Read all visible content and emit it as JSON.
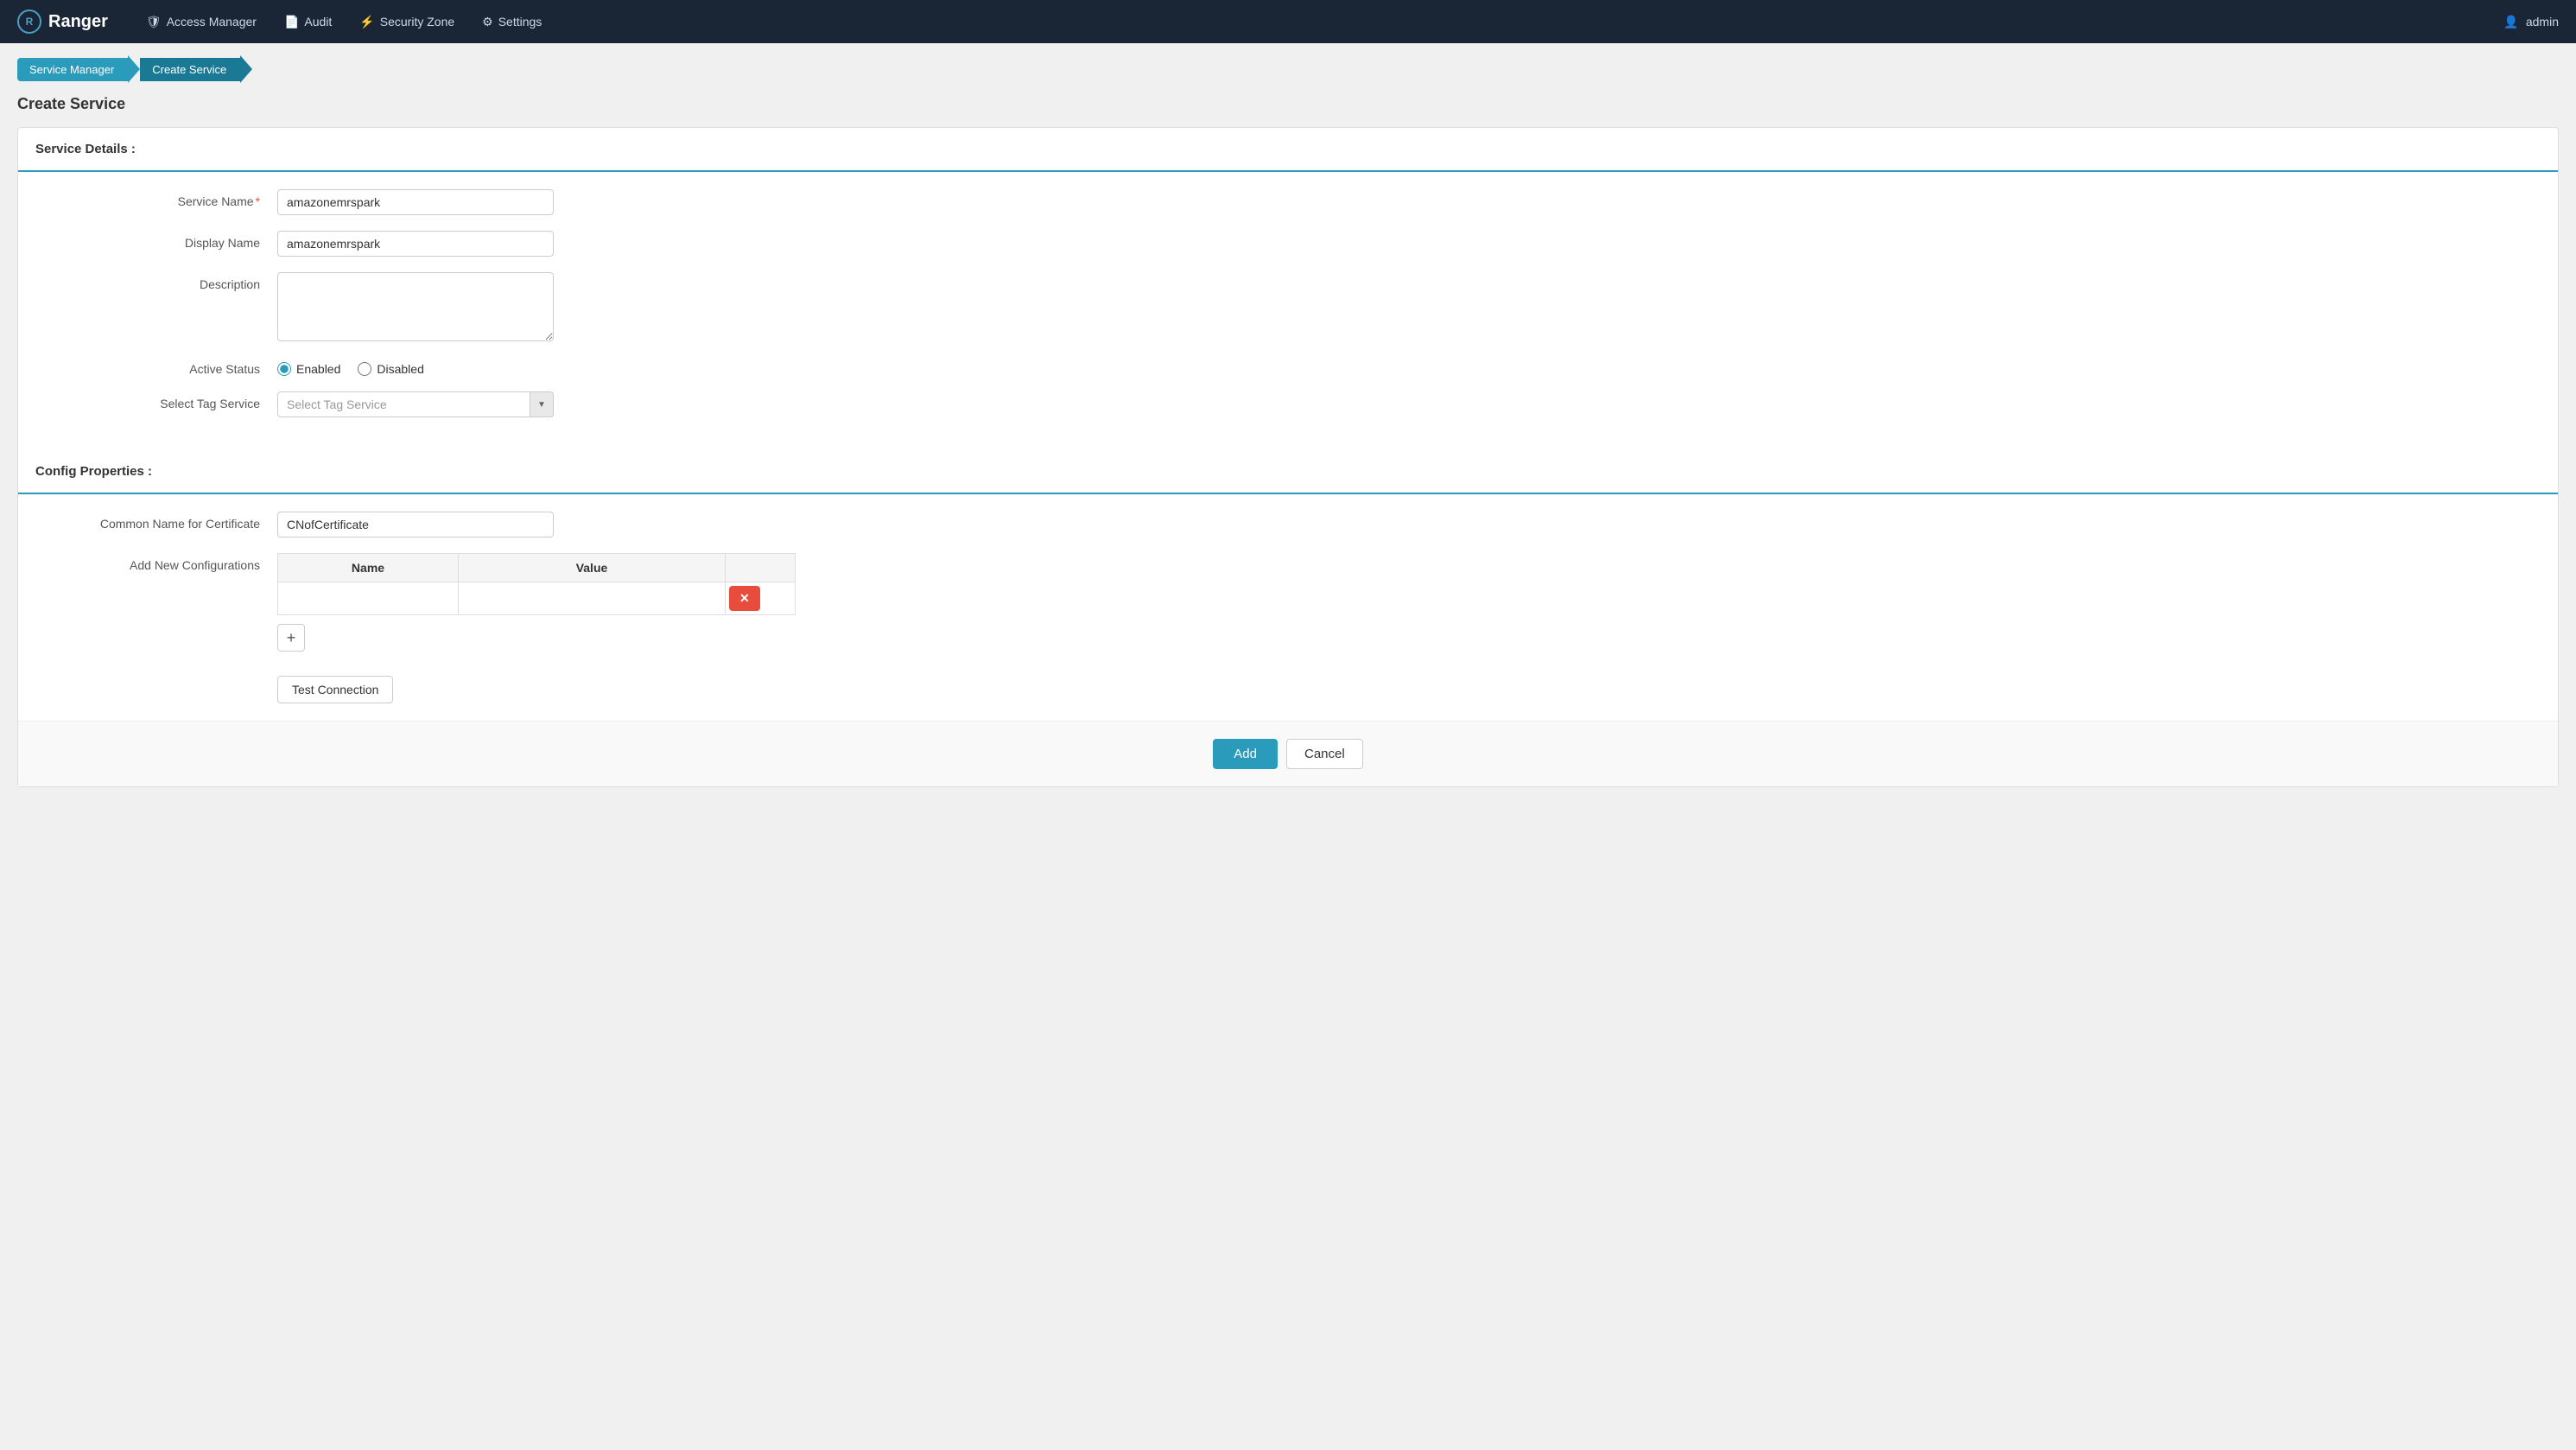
{
  "navbar": {
    "brand": "Ranger",
    "brand_icon": "R",
    "nav_items": [
      {
        "id": "access-manager",
        "label": "Access Manager",
        "icon": "🛡"
      },
      {
        "id": "audit",
        "label": "Audit",
        "icon": "📄"
      },
      {
        "id": "security-zone",
        "label": "Security Zone",
        "icon": "⚡"
      },
      {
        "id": "settings",
        "label": "Settings",
        "icon": "⚙"
      }
    ],
    "admin_label": "admin",
    "admin_icon": "👤"
  },
  "breadcrumb": {
    "items": [
      {
        "label": "Service Manager",
        "active": false
      },
      {
        "label": "Create Service",
        "active": true
      }
    ]
  },
  "page_title": "Create Service",
  "service_details": {
    "section_label": "Service Details :",
    "fields": {
      "service_name_label": "Service Name",
      "service_name_value": "amazonemrspark",
      "service_name_required": "*",
      "display_name_label": "Display Name",
      "display_name_value": "amazonemrspark",
      "description_label": "Description",
      "description_placeholder": "",
      "active_status_label": "Active Status",
      "enabled_label": "Enabled",
      "disabled_label": "Disabled",
      "select_tag_service_label": "Select Tag Service",
      "select_tag_service_placeholder": "Select Tag Service"
    }
  },
  "config_properties": {
    "section_label": "Config Properties :",
    "fields": {
      "common_name_label": "Common Name for Certificate",
      "common_name_value": "CNofCertificate",
      "add_new_config_label": "Add New Configurations",
      "name_col_header": "Name",
      "value_col_header": "Value"
    },
    "rows": [
      {
        "name": "",
        "value": ""
      }
    ]
  },
  "buttons": {
    "test_connection": "Test Connection",
    "add": "Add",
    "cancel": "Cancel",
    "add_row": "+",
    "remove_row": "✕"
  }
}
